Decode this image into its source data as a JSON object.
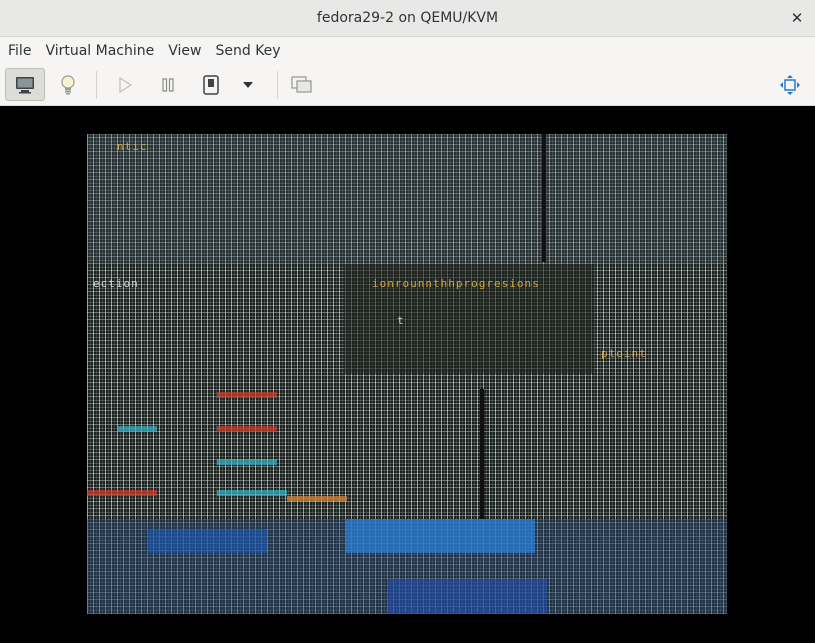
{
  "window": {
    "title": "fedora29-2 on QEMU/KVM"
  },
  "menubar": {
    "items": [
      "File",
      "Virtual Machine",
      "View",
      "Send Key"
    ]
  },
  "toolbar": {
    "buttons": [
      {
        "name": "graphical-console",
        "icon": "monitor-icon",
        "active": true
      },
      {
        "name": "details",
        "icon": "lightbulb-icon"
      },
      {
        "name": "run",
        "icon": "play-icon"
      },
      {
        "name": "pause",
        "icon": "pause-icon"
      },
      {
        "name": "shutdown",
        "icon": "power-icon"
      },
      {
        "name": "shutdown-menu",
        "icon": "chevron-down-icon"
      },
      {
        "name": "snapshots",
        "icon": "snapshots-icon"
      },
      {
        "name": "fullscreen",
        "icon": "fullscreen-icon"
      }
    ]
  },
  "guest_display": {
    "description_hidden": true,
    "glitch_text": [
      "ntic",
      "ionrounnthhprogresions",
      "ection",
      "t",
      "ptoint"
    ]
  }
}
